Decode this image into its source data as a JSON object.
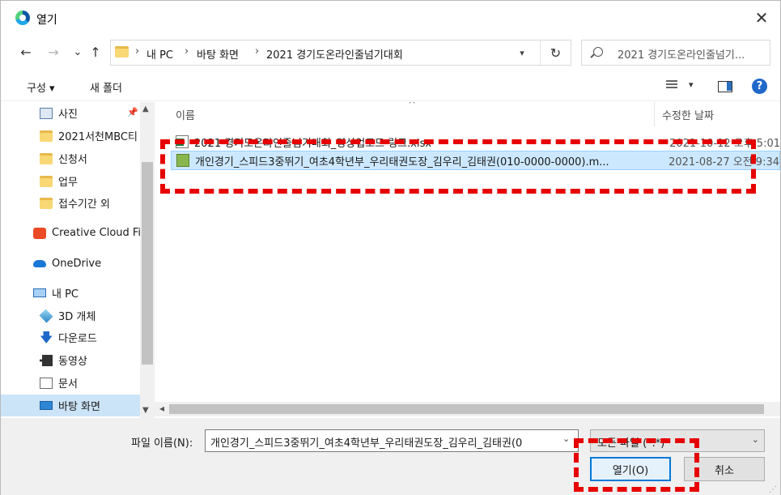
{
  "window": {
    "title": "열기",
    "close_glyph": "✕"
  },
  "nav": {
    "back": "←",
    "forward": "→",
    "recent": "⌄",
    "up": "↑",
    "breadcrumb": [
      "내 PC",
      "바탕 화면",
      "2021 경기도온라인줄넘기대회"
    ],
    "separator": "›",
    "refresh": "↻",
    "search_placeholder": "2021 경기도온라인줄넘기..."
  },
  "commands": {
    "organize": "구성 ▾",
    "new_folder": "새 폴더",
    "help": "?"
  },
  "sidebar": {
    "items": [
      {
        "label": "사진",
        "icon": "photos-icon"
      },
      {
        "label": "2021서천MBC티",
        "icon": "folder-icon"
      },
      {
        "label": "신청서",
        "icon": "folder-icon"
      },
      {
        "label": "업무",
        "icon": "folder-icon"
      },
      {
        "label": "접수기간 외",
        "icon": "folder-icon"
      },
      {
        "label": "Creative Cloud Fil",
        "icon": "creative-cloud-icon"
      },
      {
        "label": "OneDrive",
        "icon": "onedrive-icon"
      },
      {
        "label": "내 PC",
        "icon": "pc-icon"
      },
      {
        "label": "3D 개체",
        "icon": "3d-objects-icon"
      },
      {
        "label": "다운로드",
        "icon": "download-icon"
      },
      {
        "label": "동영상",
        "icon": "video-icon"
      },
      {
        "label": "문서",
        "icon": "documents-icon"
      },
      {
        "label": "바탕 화면",
        "icon": "desktop-icon"
      }
    ],
    "pin": "📌"
  },
  "filelist": {
    "col_name": "이름",
    "col_date": "수정한 날짜",
    "sort_arrow": "^",
    "files": [
      {
        "name": "2021 경기도온라인줄넘기대회_영상업로드 링크.xlsx",
        "date": "2021-10-12 오후 5:01",
        "type": "xlsx"
      },
      {
        "name": "개인경기_스피드3중뛰기_여초4학년부_우리태권도장_김우리_김태권(010-0000-0000).m...",
        "date": "2021-08-27 오전 9:34",
        "type": "mp4"
      }
    ]
  },
  "bottom": {
    "filename_label": "파일 이름(N):",
    "filename_value": "개인경기_스피드3중뛰기_여초4학년부_우리태권도장_김우리_김태권(0",
    "filetype_value": "모든 파일 (*.*)",
    "open_label": "열기(O)",
    "cancel_label": "취소"
  }
}
